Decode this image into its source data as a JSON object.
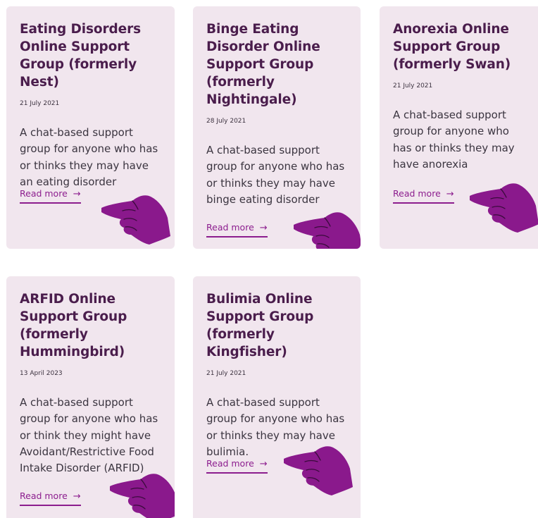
{
  "cards": [
    {
      "title": "Eating Disorders Online Support Group (formerly Nest)",
      "date": "21 July 2021",
      "description": "A chat-based support group for anyone who has or thinks they may have an eating disorder",
      "link_label": "Read more",
      "link_arrow": "→",
      "hand_icon": "pointing-hand-icon"
    },
    {
      "title": "Binge Eating Disorder Online Support Group (formerly Nightingale)",
      "date": "28 July 2021",
      "description": "A chat-based support group for anyone who has or thinks they may have binge eating disorder",
      "link_label": "Read more",
      "link_arrow": "→",
      "hand_icon": "pointing-hand-icon"
    },
    {
      "title": "Anorexia Online Support Group (formerly Swan)",
      "date": "21 July 2021",
      "description": "A chat-based support group for anyone who has or thinks they may have anorexia",
      "link_label": "Read more",
      "link_arrow": "→",
      "hand_icon": "pointing-hand-icon"
    },
    {
      "title": "ARFID Online Support Group (formerly Hummingbird)",
      "date": "13 April 2023",
      "description": "A chat-based support group for anyone who has or think they might have Avoidant/Restrictive Food Intake Disorder (ARFID)",
      "link_label": "Read more",
      "link_arrow": "→",
      "hand_icon": "pointing-hand-icon"
    },
    {
      "title": "Bulimia Online Support Group (formerly Kingfisher)",
      "date": "21 July 2021",
      "description": "A chat-based support group for anyone who has or thinks they may have bulimia.",
      "link_label": "Read more",
      "link_arrow": "→",
      "hand_icon": "pointing-hand-icon"
    }
  ],
  "colors": {
    "card_background": "#f1e6ee",
    "title": "#4a1d4c",
    "link": "#8c1d8e",
    "hand": "#8a198c"
  }
}
